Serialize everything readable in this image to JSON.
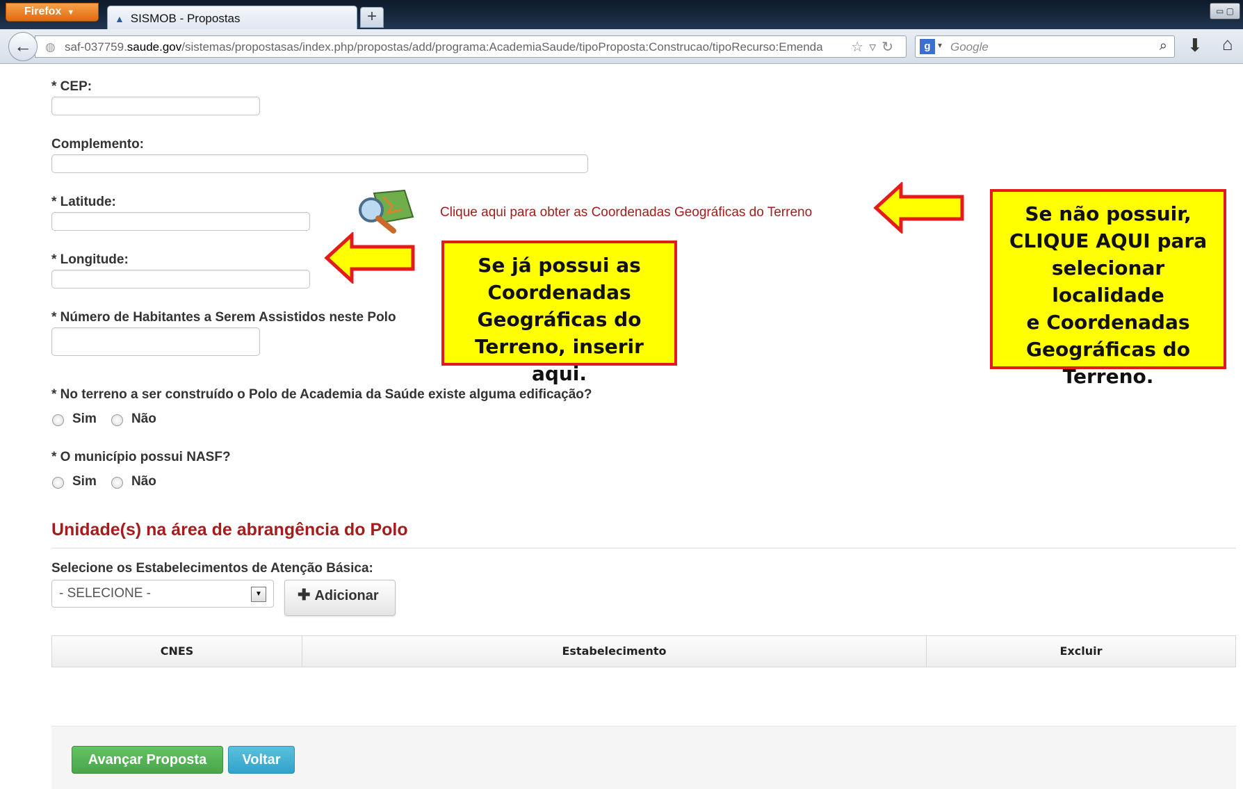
{
  "browser": {
    "app_button": "Firefox",
    "tab_title": "SISMOB - Propostas",
    "url_prefix": "saf-037759.",
    "url_host": "saude.gov",
    "url_path": "/sistemas/propostasas/index.php/propostas/add/programa:AcademiaSaude/tipoProposta:Construcao/tipoRecurso:Emenda",
    "search_placeholder": "Google",
    "icons": [
      "back-arrow-icon",
      "globe-icon",
      "star-icon",
      "reload-icon",
      "google-icon",
      "search-icon",
      "download-icon",
      "home-icon"
    ]
  },
  "form": {
    "cep_label": "* CEP:",
    "complemento_label": "Complemento:",
    "latitude_label": "* Latitude:",
    "longitude_label": "* Longitude:",
    "habitantes_label": "* Número de Habitantes a Serem Assistidos neste Polo",
    "geo_link": "Clique aqui para obter as Coordenadas Geográficas do Terreno",
    "edificacao_label": "* No terreno a ser construído o Polo de Academia da Saúde existe alguma edificação?",
    "nasf_label": "* O município possui NASF?",
    "option_sim": "Sim",
    "option_nao": "Não"
  },
  "unidades": {
    "section_title": "Unidade(s) na área de abrangência do Polo",
    "select_label": "Selecione os Estabelecimentos de Atenção Básica:",
    "select_value": "- SELECIONE -",
    "add_button": "Adicionar",
    "columns": [
      "CNES",
      "Estabelecimento",
      "Excluir"
    ]
  },
  "footer": {
    "advance_button": "Avançar Proposta",
    "back_button": "Voltar"
  },
  "annotations": {
    "left_callout": [
      "Se já possui as",
      "Coordenadas",
      "Geográficas do",
      "Terreno, inserir aqui."
    ],
    "right_callout": [
      "Se não possuir,",
      "CLIQUE AQUI para",
      "selecionar localidade",
      "e Coordenadas",
      "Geográficas do",
      "Terreno."
    ],
    "highlight_color": "#ffff00",
    "border_color": "#e31b1b"
  }
}
